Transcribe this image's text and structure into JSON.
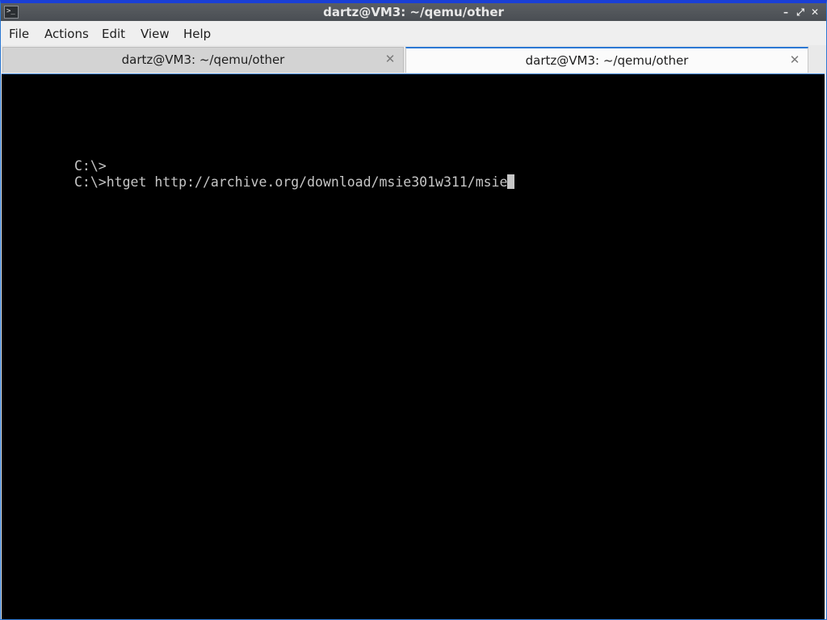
{
  "window": {
    "title": "dartz@VM3: ~/qemu/other",
    "icon": "terminal-icon",
    "buttons": {
      "minimize": "–",
      "restore": "⤢",
      "close": "✕"
    }
  },
  "menubar": {
    "items": [
      {
        "label": "File"
      },
      {
        "label": "Actions"
      },
      {
        "label": "Edit"
      },
      {
        "label": "View"
      },
      {
        "label": "Help"
      }
    ]
  },
  "tabs": [
    {
      "label": "dartz@VM3: ~/qemu/other",
      "active": false,
      "close": "✕"
    },
    {
      "label": "dartz@VM3: ~/qemu/other",
      "active": true,
      "close": "✕"
    }
  ],
  "terminal": {
    "lines": [
      "C:\\>",
      "C:\\>htget http://archive.org/download/msie301w311/msie"
    ]
  },
  "colors": {
    "accent": "#2b78d3",
    "titlebar": "#4e5257",
    "terminal_bg": "#000000",
    "terminal_fg": "#c6c6c6"
  }
}
